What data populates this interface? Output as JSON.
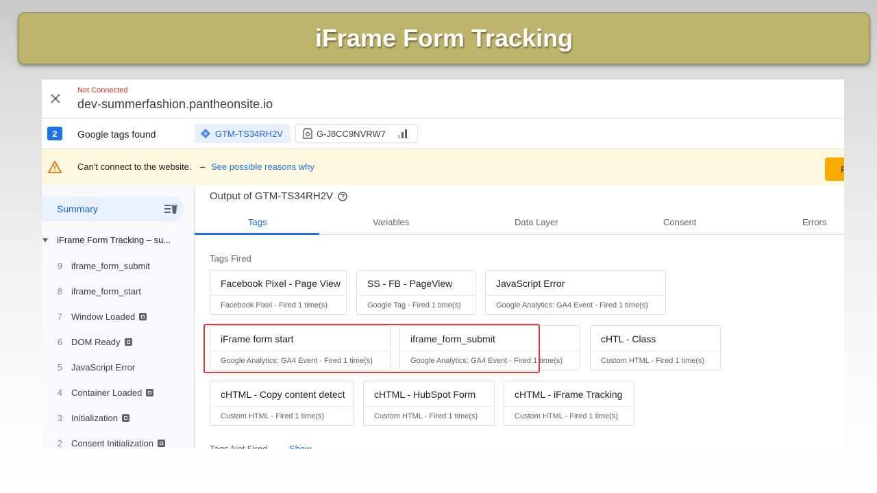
{
  "banner": {
    "title": "iFrame Form Tracking"
  },
  "header": {
    "status": "Not Connected",
    "domain": "dev-summerfashion.pantheonsite.io"
  },
  "tags_bar": {
    "count": "2",
    "label": "Google tags found",
    "chips": [
      "GTM-TS34RH2V",
      "G-J8CC9NVRW7"
    ]
  },
  "warning": {
    "message": "Can't connect to the website.",
    "dash": "–",
    "link": "See possible reasons why",
    "button_partial": "F"
  },
  "sidebar": {
    "summary": "Summary",
    "group": "iFrame Form Tracking – su...",
    "events": [
      {
        "num": "9",
        "label": "iframe_form_submit",
        "icon": false
      },
      {
        "num": "8",
        "label": "iframe_form_start",
        "icon": false
      },
      {
        "num": "7",
        "label": "Window Loaded",
        "icon": true
      },
      {
        "num": "6",
        "label": "DOM Ready",
        "icon": true
      },
      {
        "num": "5",
        "label": "JavaScript Error",
        "icon": false
      },
      {
        "num": "4",
        "label": "Container Loaded",
        "icon": true
      },
      {
        "num": "3",
        "label": "Initialization",
        "icon": true
      },
      {
        "num": "2",
        "label": "Consent Initialization",
        "icon": true
      }
    ]
  },
  "main": {
    "title": "Output of GTM-TS34RH2V",
    "tabs": [
      "Tags",
      "Variables",
      "Data Layer",
      "Consent",
      "Errors"
    ],
    "tags_fired_label": "Tags Fired",
    "tags_fired": [
      {
        "name": "Facebook Pixel - Page View",
        "sub": "Facebook Pixel - Fired 1 time(s)"
      },
      {
        "name": "SS - FB - PageView",
        "sub": "Google Tag - Fired 1 time(s)"
      },
      {
        "name": "JavaScript Error",
        "sub": "Google Analytics: GA4 Event - Fired 1 time(s)"
      },
      {
        "name": "iFrame form start",
        "sub": "Google Analytics: GA4 Event - Fired 1 time(s)"
      },
      {
        "name": "iframe_form_submit",
        "sub": "Google Analytics: GA4 Event - Fired 1 time(s)"
      },
      {
        "name": "",
        "sub": ""
      },
      {
        "name": "cHTL - Class",
        "sub": "Custom HTML - Fired 1 time(s)"
      },
      {
        "name": "cHTML - Copy content detect",
        "sub": "Custom HTML - Fired 1 time(s)"
      },
      {
        "name": "cHTML - HubSpot Form",
        "sub": "Custom HTML - Fired 1 time(s)"
      },
      {
        "name": "cHTML - iFrame Tracking",
        "sub": "Custom HTML - Fired 1 time(s)"
      }
    ],
    "tags_not_fired_label": "Tags Not Fired",
    "show_link": "Show"
  },
  "colors": {
    "accent": "#1a73e8",
    "banner": "#bdb36a",
    "highlight": "#e53935",
    "warning_bg": "#fef7e0"
  }
}
